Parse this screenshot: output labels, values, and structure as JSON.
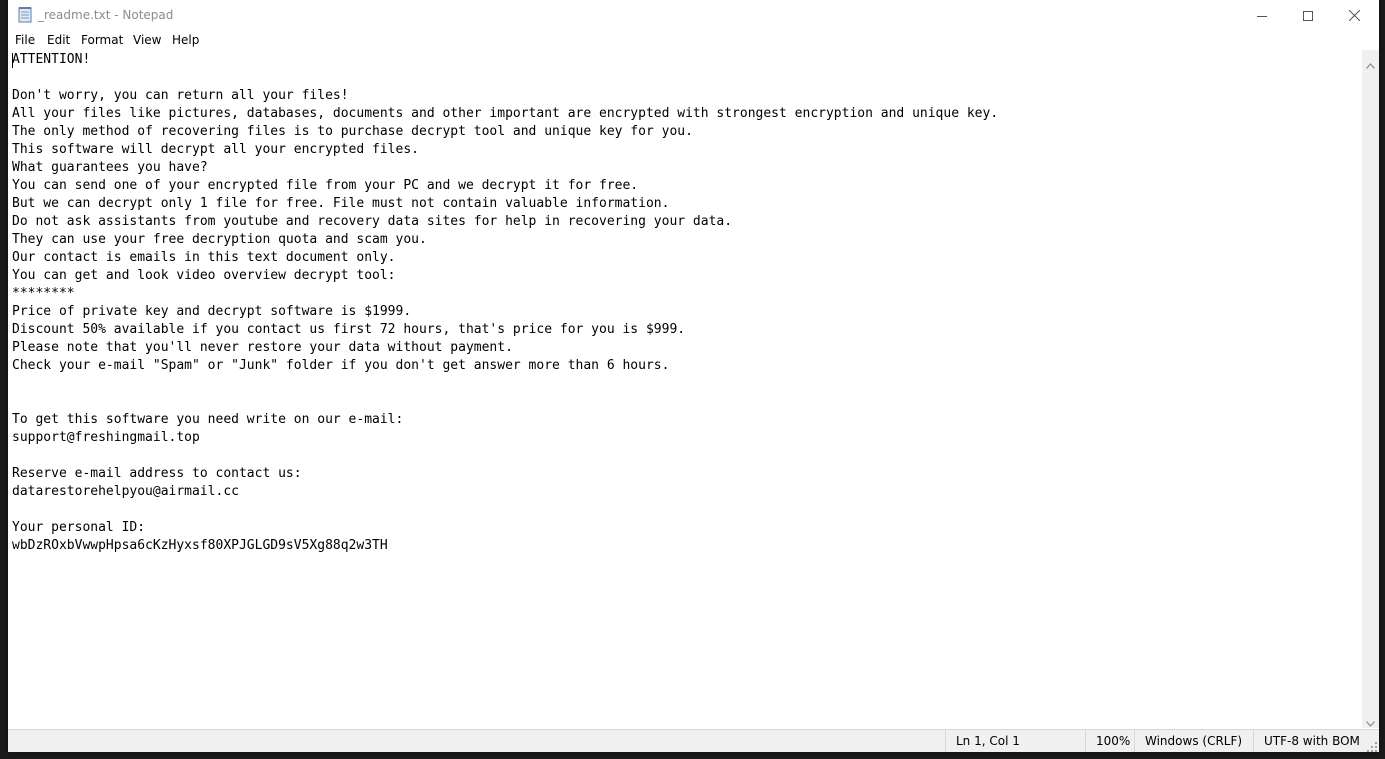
{
  "window": {
    "title": "_readme.txt - Notepad"
  },
  "menu": {
    "items": [
      "File",
      "Edit",
      "Format",
      "View",
      "Help"
    ]
  },
  "document": {
    "text": "ATTENTION!\n\nDon't worry, you can return all your files!\nAll your files like pictures, databases, documents and other important are encrypted with strongest encryption and unique key.\nThe only method of recovering files is to purchase decrypt tool and unique key for you.\nThis software will decrypt all your encrypted files.\nWhat guarantees you have?\nYou can send one of your encrypted file from your PC and we decrypt it for free.\nBut we can decrypt only 1 file for free. File must not contain valuable information.\nDo not ask assistants from youtube and recovery data sites for help in recovering your data.\nThey can use your free decryption quota and scam you.\nOur contact is emails in this text document only.\nYou can get and look video overview decrypt tool:\n********\nPrice of private key and decrypt software is $1999.\nDiscount 50% available if you contact us first 72 hours, that's price for you is $999.\nPlease note that you'll never restore your data without payment.\nCheck your e-mail \"Spam\" or \"Junk\" folder if you don't get answer more than 6 hours.\n\n\nTo get this software you need write on our e-mail:\nsupport@freshingmail.top\n\nReserve e-mail address to contact us:\ndatarestorehelpyou@airmail.cc\n\nYour personal ID:\nwbDzROxbVwwpHpsa6cKzHyxsf80XPJGLGD9sV5Xg88q2w3TH"
  },
  "status": {
    "position": "Ln 1, Col 1",
    "zoom": "100%",
    "line_ending": "Windows (CRLF)",
    "encoding": "UTF-8 with BOM"
  },
  "icons": {
    "app": "notepad-icon",
    "minimize": "minimize-icon",
    "maximize": "maximize-icon",
    "close": "close-icon",
    "scroll_up": "scroll-up-icon",
    "scroll_down": "scroll-down-icon",
    "grip": "resize-grip-icon"
  }
}
